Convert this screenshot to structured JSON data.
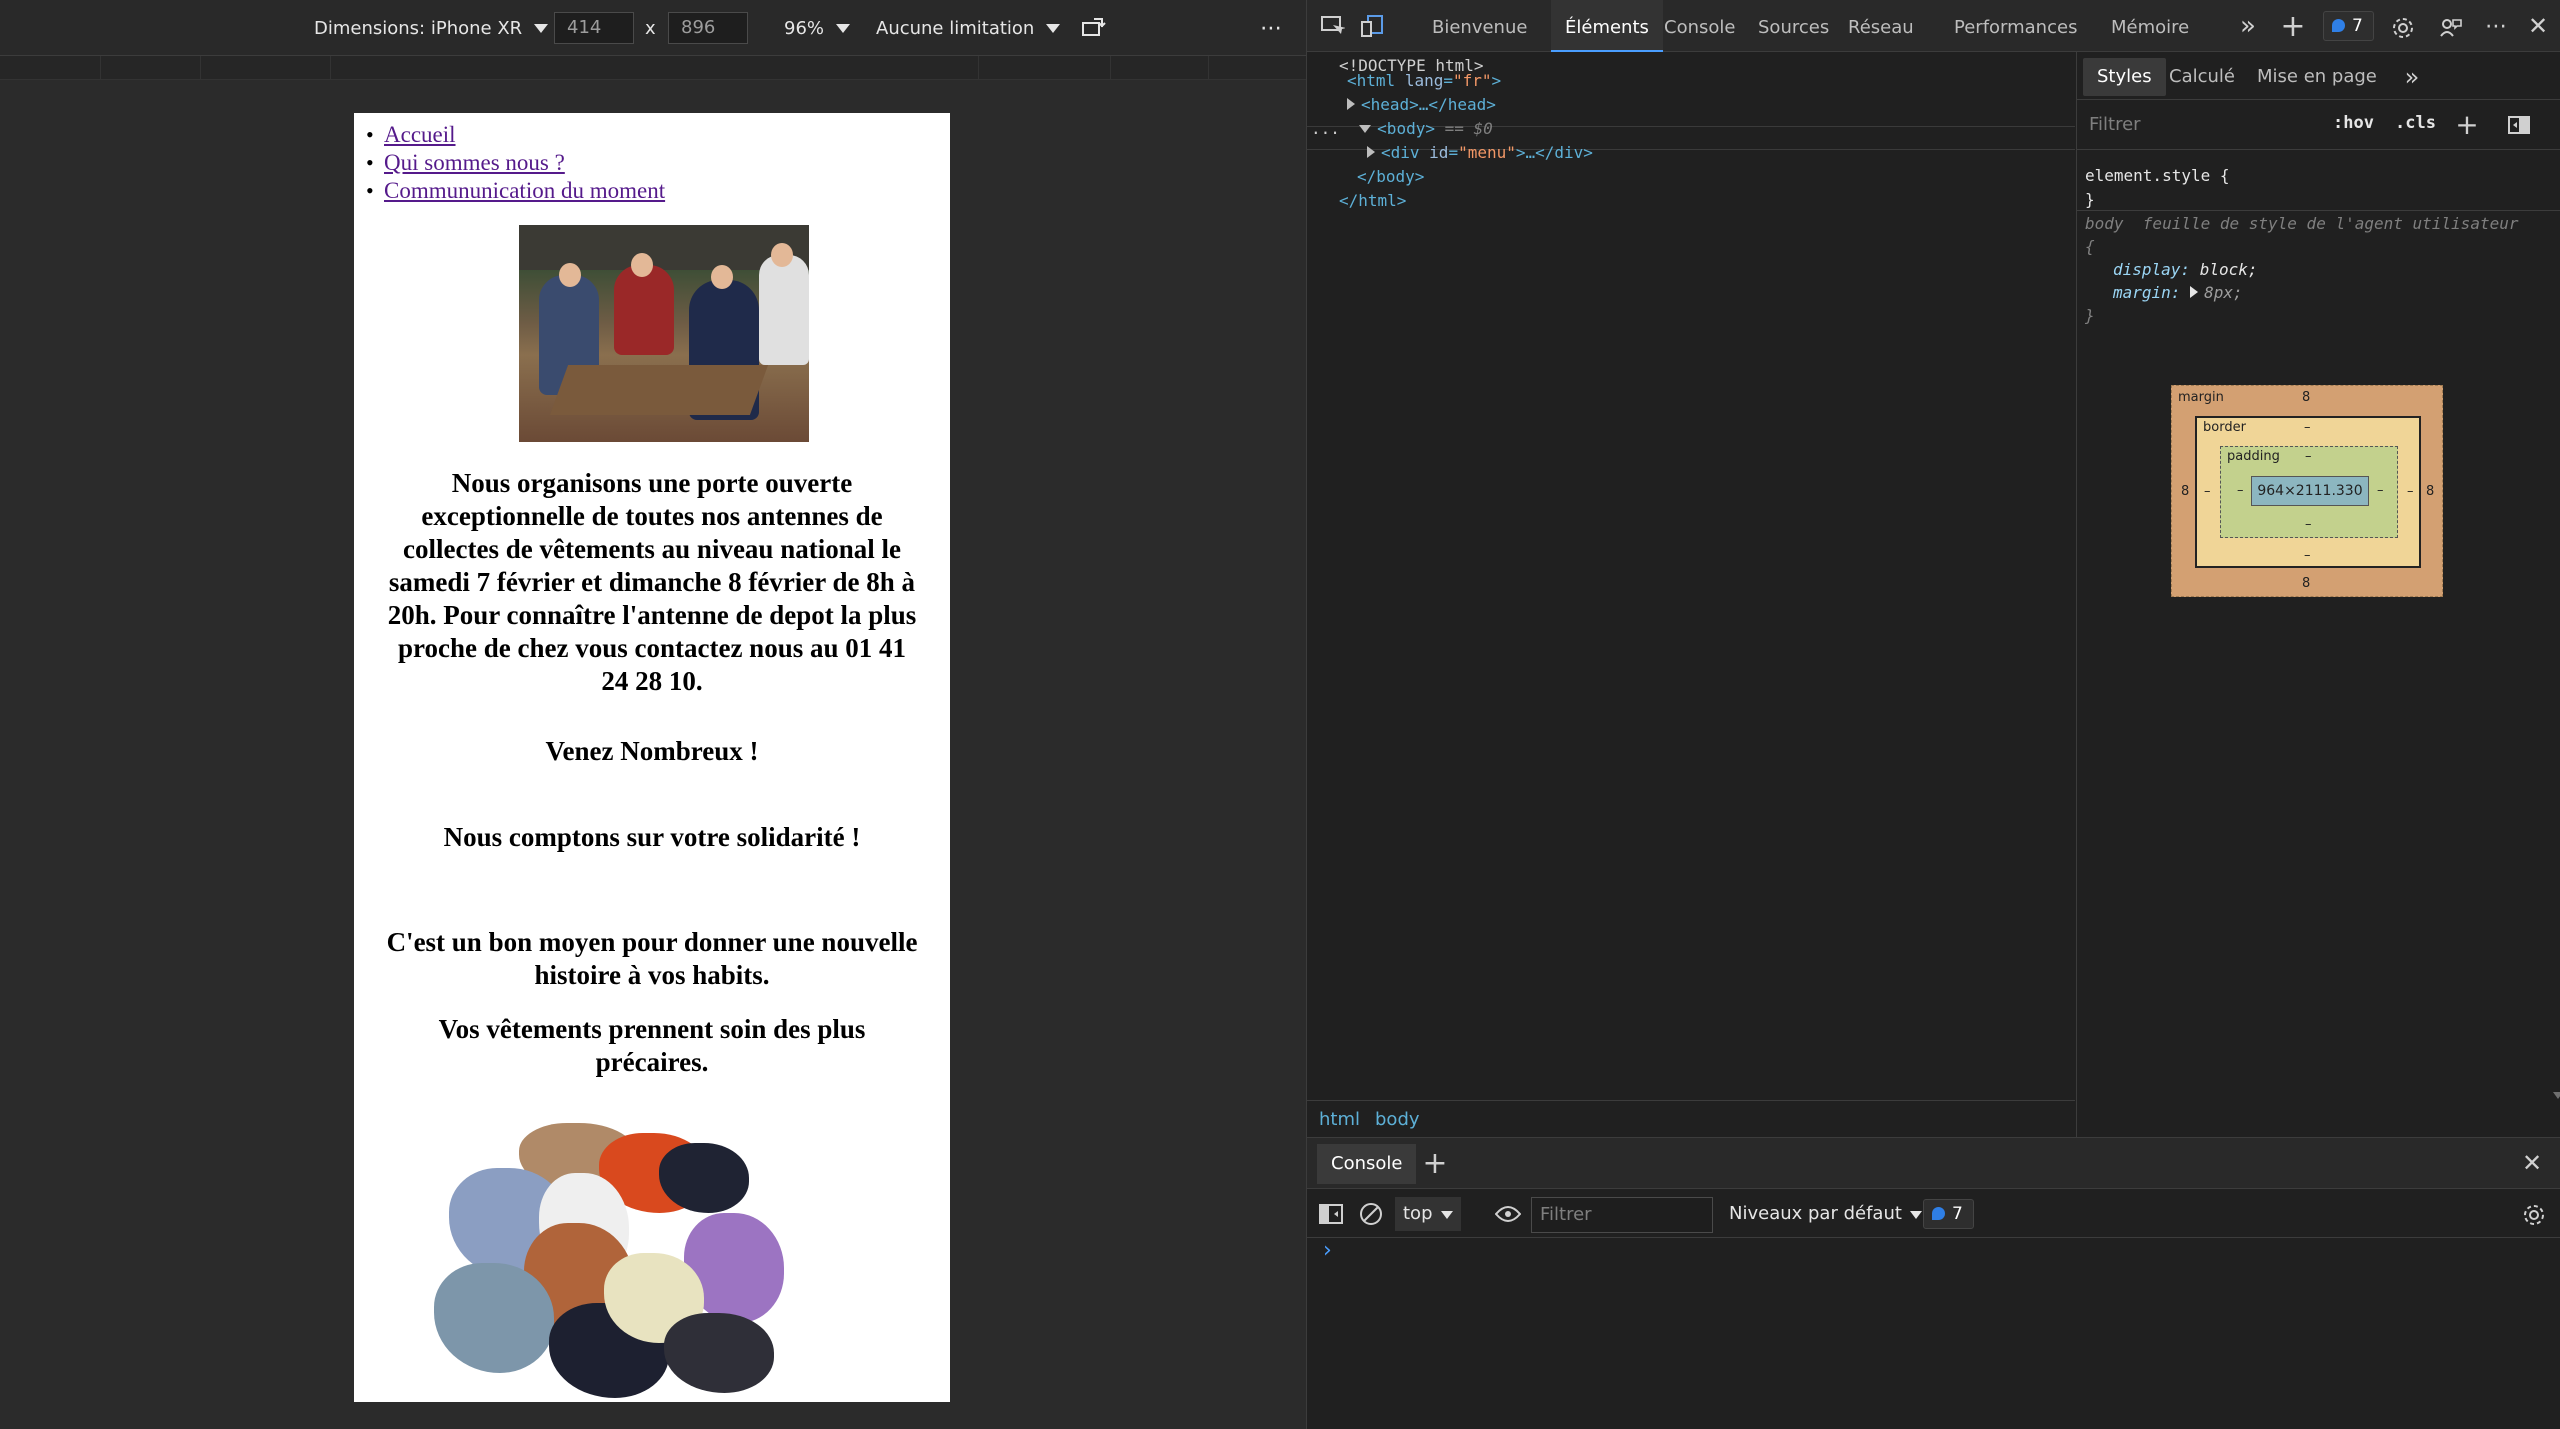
{
  "emulation": {
    "device_label": "Dimensions: iPhone XR",
    "width": "414",
    "times": "x",
    "height": "896",
    "zoom": "96%",
    "throttle": "Aucune limitation"
  },
  "page": {
    "menu": [
      "Accueil",
      "Qui sommes nous ?",
      "Commununication du moment"
    ],
    "announcement": "Nous organisons une porte ouverte exceptionnelle de toutes nos antennes de collectes de vêtements au niveau national le samedi 7 février et dimanche 8 février de 8h à 20h. Pour connaître l'antenne de depot la plus proche de chez vous contactez nous au 01 41 24 28 10.",
    "come": "Venez Nombreux !",
    "solidarity": "Nous comptons sur votre solidarité !",
    "story": "C'est un bon moyen pour donner une nouvelle histoire à vos habits.",
    "care": "Vos vêtements prennent soin des plus précaires."
  },
  "devtools": {
    "tabs": [
      "Bienvenue",
      "Éléments",
      "Console",
      "Sources",
      "Réseau",
      "Performances",
      "Mémoire"
    ],
    "active_tab": "Éléments",
    "issues_count": "7",
    "dom": {
      "doctype": "<!DOCTYPE html>",
      "html_open_tag": "<html",
      "html_lang_attr": "lang",
      "html_lang_value": "\"fr\"",
      "head": "<head>…</head>",
      "body_open": "<body>",
      "body_eq": "== $0",
      "div_open": "<div",
      "div_attr": "id",
      "div_value": "\"menu\"",
      "div_close": ">…</div>",
      "body_close": "</body>",
      "html_close": "</html>",
      "ellipsis": "..."
    },
    "breadcrumb": [
      "html",
      "body"
    ],
    "styles_tabs": [
      "Styles",
      "Calculé",
      "Mise en page"
    ],
    "styles_filter_placeholder": "Filtrer",
    "hov": ":hov",
    "cls": ".cls",
    "rules": {
      "element_style": "element.style {",
      "close": "}",
      "selector": "body",
      "source": "feuille de style de l'agent utilisateur",
      "open": "{",
      "display_prop": "display:",
      "display_val": "block;",
      "margin_prop": "margin:",
      "margin_val": "8px;"
    },
    "box_model": {
      "margin_label": "margin",
      "margin_top": "8",
      "margin_bottom": "8",
      "margin_left": "8",
      "margin_right": "8",
      "border_label": "border",
      "border_top": "–",
      "border_bottom": "–",
      "border_left": "–",
      "border_right": "–",
      "padding_label": "padding",
      "padding_top": "–",
      "padding_bottom": "–",
      "padding_left": "–",
      "padding_right": "–",
      "content": "964×2111.330"
    },
    "console": {
      "tab": "Console",
      "context": "top",
      "filter_placeholder": "Filtrer",
      "levels": "Niveaux par défaut",
      "issues_count": "7",
      "prompt": "›"
    }
  }
}
